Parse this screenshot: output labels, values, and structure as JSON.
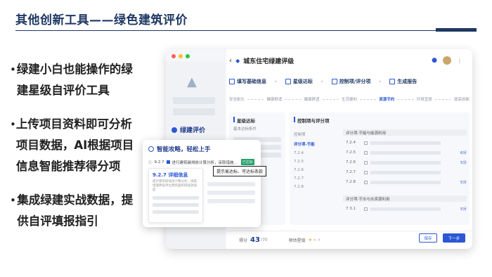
{
  "slide": {
    "title": "其他创新工具——绿色建筑评价",
    "bullets": [
      "绿建小白也能操作的绿建星级自评价工具",
      "上传项目资料即可分析项目数据，AI根据项目信息智能推荐得分项",
      "集成绿建实战数据，提供自评填报指引"
    ]
  },
  "app": {
    "project_title": "城东住宅绿建评级",
    "sidebar_active": "绿建评价",
    "steps": [
      "填写基础信息",
      "星级达标",
      "控制项/评分项",
      "生成报告"
    ],
    "progress": [
      "安全耐久",
      "健康舒适",
      "健康舒适",
      "生活便利",
      "资源节约",
      "环境宜居",
      "提高创新"
    ],
    "left_col": {
      "title": "星级达标",
      "subtitle": "基本达标条件"
    },
    "right_col": {
      "title": "控制项与评分项",
      "tree": [
        "控制项",
        "评分项-节能",
        "7.2.4",
        "7.2.5",
        "7.2.6",
        "7.2.7",
        "7.2.8"
      ],
      "group1": "评分项-节能与能源利用",
      "group2": "评分项-节水与水资源利用",
      "rows": [
        {
          "code": "7.2.4",
          "score": ""
        },
        {
          "code": "7.2.5",
          "score": "6分"
        },
        {
          "code": "7.2.6",
          "score": "5分"
        },
        {
          "code": "7.2.7",
          "score": ""
        },
        {
          "code": "7.2.8",
          "score": "5分"
        }
      ],
      "row_last": {
        "code": "7.3.1",
        "score": "5分"
      }
    },
    "footer": {
      "score_label": "得分",
      "score": "43",
      "score_total": "/70",
      "stars_label": "预估星级",
      "stars_on": 1,
      "stars_total": 3,
      "save": "保存",
      "next": "下一步"
    }
  },
  "popup": {
    "title": "智能攻略，轻松上手",
    "item_code": "9.2.7",
    "item_text": "进行建筑碳排放计算分析，采取措施...",
    "achieved": "已达标",
    "tooltip": "提示易达标、可达标条款",
    "detail_title": "9.2.7 详细信息",
    "detail_desc": "提示建筑碳排放计算分析，采取措施降低单位建筑面积碳排放强度"
  },
  "colors": {
    "navy": "#1f3864",
    "accent": "#2b56d6",
    "green": "#22a06b",
    "star": "#f5a623"
  }
}
